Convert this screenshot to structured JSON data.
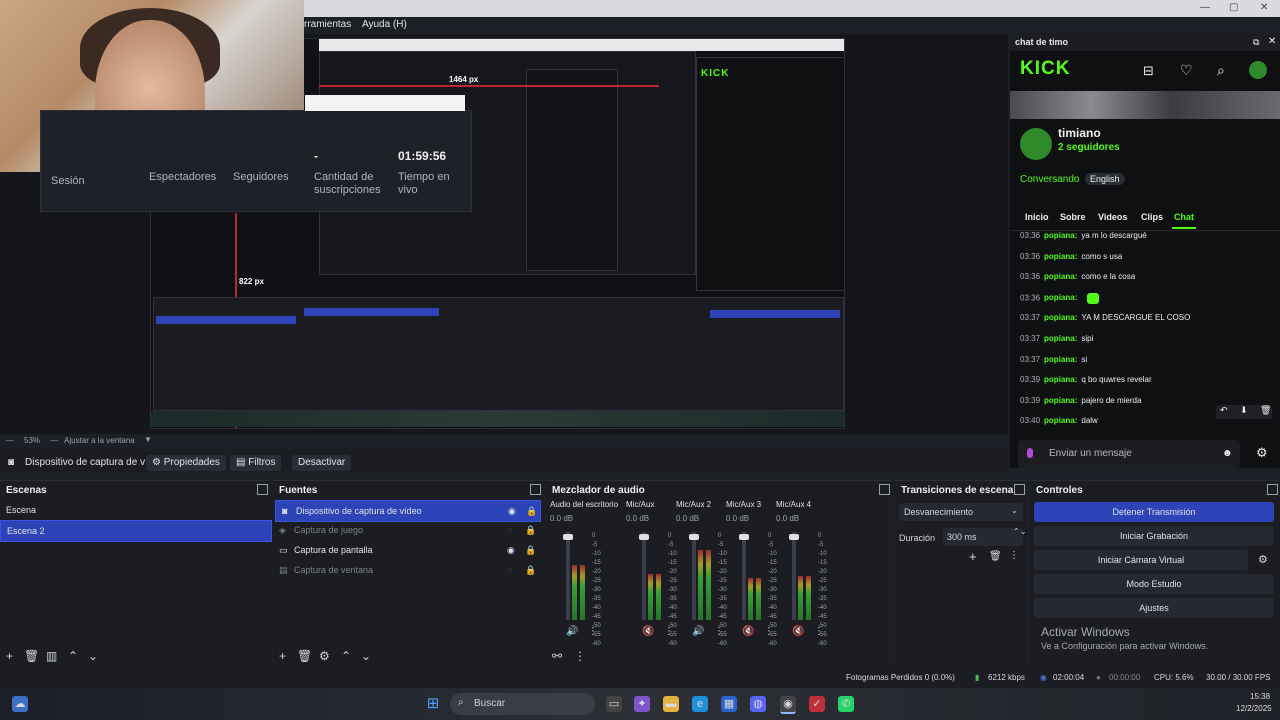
{
  "menu": {
    "items": [
      "rramientas",
      "Ayuda (H)"
    ],
    "win_controls": [
      "—",
      "▢",
      "✕"
    ]
  },
  "webcam": {
    "stats": {
      "labels": [
        "Sesión",
        "Espectadores",
        "Seguidores",
        "Cantidad de suscripciones",
        "Tiempo en vivo"
      ],
      "dash": "-",
      "time": "01:59:56"
    }
  },
  "preview": {
    "size_label_1": "1464 px",
    "size_label_2": "822 px",
    "zoom": "53%",
    "fit_label": "Ajustar a la ventana"
  },
  "source_toolbar": {
    "source_name": "Dispositivo de captura de v",
    "properties": "Propiedades",
    "filters": "Filtros",
    "deactivate": "Desactivar"
  },
  "scenes": {
    "title": "Escenas",
    "items": [
      "Escena",
      "Escena 2"
    ],
    "selected": 1
  },
  "sources": {
    "title": "Fuentes",
    "items": [
      {
        "label": "Dispositivo de captura de vídeo",
        "selected": true,
        "dim": false
      },
      {
        "label": "Captura de juego",
        "selected": false,
        "dim": true
      },
      {
        "label": "Captura de pantalla",
        "selected": false,
        "dim": false
      },
      {
        "label": "Captura de ventana",
        "selected": false,
        "dim": true
      }
    ]
  },
  "mixer": {
    "title": "Mezclador de audio",
    "channels": [
      {
        "name": "Audio del escritorio",
        "db": "0.0 dB",
        "level": 0.62,
        "muted": false
      },
      {
        "name": "Mic/Aux",
        "db": "0.0 dB",
        "level": 0.52,
        "muted": true
      },
      {
        "name": "Mic/Aux 2",
        "db": "0.0 dB",
        "level": 0.8,
        "muted": false
      },
      {
        "name": "Mic/Aux 3",
        "db": "0.0 dB",
        "level": 0.48,
        "muted": true
      },
      {
        "name": "Mic/Aux 4",
        "db": "0.0 dB",
        "level": 0.5,
        "muted": true
      }
    ],
    "scale": [
      "0",
      "-5",
      "-10",
      "-15",
      "-20",
      "-25",
      "-30",
      "-35",
      "-40",
      "-45",
      "-50",
      "-55",
      "-60"
    ]
  },
  "transitions": {
    "title": "Transiciones de escena",
    "selected": "Desvanecimiento",
    "duration_label": "Duración",
    "duration_value": "300 ms"
  },
  "controls": {
    "title": "Controles",
    "buttons": [
      "Detener Transmisión",
      "Iniciar Grabación",
      "Iniciar Cámara Virtual",
      "Modo Estudio",
      "Ajustes"
    ]
  },
  "activate_windows": {
    "title": "Activar Windows",
    "subtitle": "Ve a Configuración para activar Windows."
  },
  "status": {
    "dropped": "Fotogramas Perdidos 0 (0.0%)",
    "bitrate": "6212 kbps",
    "live_time": "02:00:04",
    "rec_time": "00:00:00",
    "cpu": "CPU: 5.6%",
    "fps": "30.00 / 30.00 FPS"
  },
  "taskbar": {
    "search": "Buscar",
    "clock": "15:38",
    "date": "12/2/2025"
  },
  "chat": {
    "window_title": "chat de timo",
    "logo": "KICK",
    "channel": "timiano",
    "followers": "2 seguidores",
    "status": "Conversando",
    "language": "English",
    "tabs": [
      "Inicio",
      "Sobre",
      "Videos",
      "Clips",
      "Chat"
    ],
    "active_tab": "Chat",
    "messages": [
      {
        "time": "03:36",
        "user": "popiana:",
        "text": "ya m lo descargué"
      },
      {
        "time": "03:36",
        "user": "popiana:",
        "text": "como s usa"
      },
      {
        "time": "03:36",
        "user": "popiana:",
        "text": "como e la cosa"
      },
      {
        "time": "03:36",
        "user": "popiana:",
        "text": ""
      },
      {
        "time": "03:37",
        "user": "popiana:",
        "text": "YA M DESCARGUE EL COSO"
      },
      {
        "time": "03:37",
        "user": "popiana:",
        "text": "sipi"
      },
      {
        "time": "03:37",
        "user": "popiana:",
        "text": "si"
      },
      {
        "time": "03:39",
        "user": "popiana:",
        "text": "q bo quwres revelar"
      },
      {
        "time": "03:39",
        "user": "popiana:",
        "text": "pajero de mierda"
      },
      {
        "time": "03:40",
        "user": "popiana:",
        "text": "dalw"
      }
    ],
    "input_placeholder": "Enviar un mensaje"
  },
  "colors": {
    "accent": "#2d44b8",
    "kick_green": "#53fc18",
    "panel": "#1b1d23"
  }
}
